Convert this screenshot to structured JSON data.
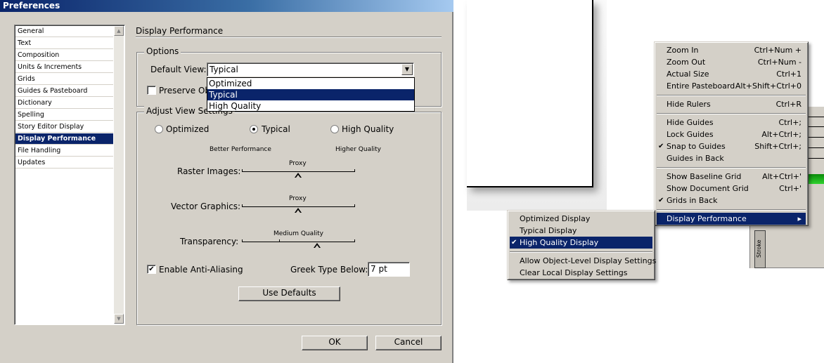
{
  "dialog": {
    "title": "Preferences",
    "sidebar_items": [
      "General",
      "Text",
      "Composition",
      "Units & Increments",
      "Grids",
      "Guides & Pasteboard",
      "Dictionary",
      "Spelling",
      "Story Editor Display",
      "Display Performance",
      "File Handling",
      "Updates"
    ],
    "selected_item": "Display Performance",
    "section_title": "Display Performance",
    "options": {
      "legend": "Options",
      "default_view_label": "Default View:",
      "default_view_value": "Typical",
      "dropdown_options": [
        "Optimized",
        "Typical",
        "High Quality"
      ],
      "preserve_label": "Preserve Ob"
    },
    "adjust": {
      "legend": "Adjust View Settings",
      "radio_optimized": "Optimized",
      "radio_typical": "Typical",
      "radio_high": "High Quality",
      "selected": "Typical",
      "better_performance": "Better Performance",
      "higher_quality": "Higher Quality",
      "raster_label": "Raster Images:",
      "raster_value": "Proxy",
      "vector_label": "Vector Graphics:",
      "vector_value": "Proxy",
      "transparency_label": "Transparency:",
      "transparency_value": "Medium Quality",
      "antialias_label": "Enable Anti-Aliasing",
      "antialias_checked": true,
      "greek_label": "Greek Type Below:",
      "greek_value": "7 pt",
      "use_defaults": "Use Defaults"
    },
    "ok_label": "OK",
    "cancel_label": "Cancel"
  },
  "view_menu": {
    "items": [
      {
        "label": "Zoom In",
        "shortcut": "Ctrl+Num +"
      },
      {
        "label": "Zoom Out",
        "shortcut": "Ctrl+Num -"
      },
      {
        "label": "Actual Size",
        "shortcut": "Ctrl+1"
      },
      {
        "label": "Entire Pasteboard",
        "shortcut": "Alt+Shift+Ctrl+0"
      },
      {
        "label": "Hide Rulers",
        "shortcut": "Ctrl+R"
      },
      {
        "label": "Hide Guides",
        "shortcut": "Ctrl+;"
      },
      {
        "label": "Lock Guides",
        "shortcut": "Alt+Ctrl+;"
      },
      {
        "label": "Snap to Guides",
        "shortcut": "Shift+Ctrl+;",
        "checked": true
      },
      {
        "label": "Guides in Back",
        "shortcut": ""
      },
      {
        "label": "Show Baseline Grid",
        "shortcut": "Alt+Ctrl+'"
      },
      {
        "label": "Show Document Grid",
        "shortcut": "Ctrl+'"
      },
      {
        "label": "Grids in Back",
        "shortcut": "",
        "checked": true
      },
      {
        "label": "Display Performance",
        "shortcut": "",
        "submenu": true
      }
    ]
  },
  "submenu": {
    "items": [
      {
        "label": "Optimized Display"
      },
      {
        "label": "Typical Display"
      },
      {
        "label": "High Quality Display",
        "checked": true
      },
      {
        "label": "Allow Object-Level Display Settings"
      },
      {
        "label": "Clear Local Display Settings"
      }
    ]
  },
  "panel_tab": "Stroke",
  "icons": {
    "check": "checkmark-icon",
    "arrow_right": "submenu-arrow-icon",
    "dropdown": "dropdown-arrow-icon"
  }
}
